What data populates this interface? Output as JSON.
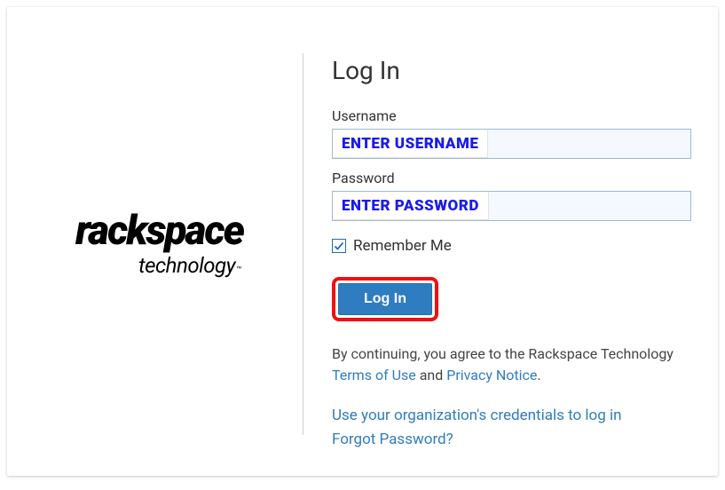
{
  "logo": {
    "main": "rackspace",
    "sub": "technology"
  },
  "title": "Log In",
  "form": {
    "username_label": "Username",
    "username_overlay": "ENTER USERNAME",
    "password_label": "Password",
    "password_overlay": "ENTER PASSWORD",
    "remember_label": "Remember Me",
    "login_button": "Log In"
  },
  "disclaimer": {
    "prefix": "By continuing, you agree to the Rackspace Technology ",
    "terms": "Terms of Use",
    "mid": " and ",
    "privacy": "Privacy Notice",
    "suffix": "."
  },
  "links": {
    "sso": "Use your organization's credentials to log in",
    "forgot": "Forgot Password?"
  }
}
